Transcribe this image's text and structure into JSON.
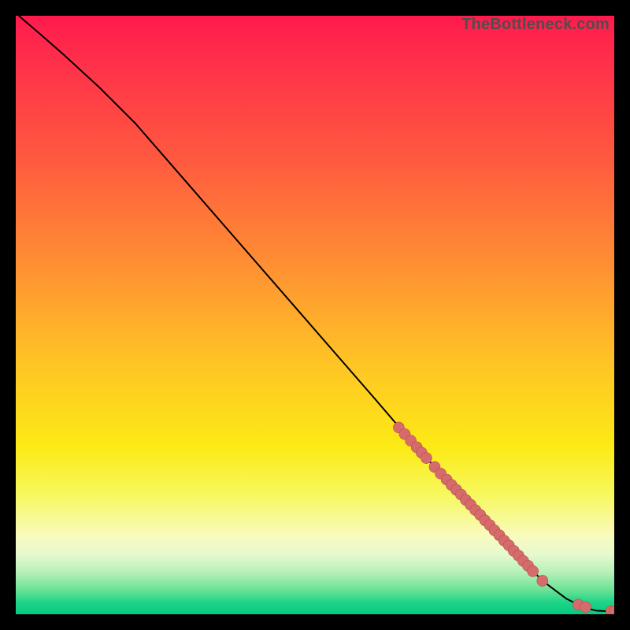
{
  "watermark": "TheBottleneck.com",
  "chart_data": {
    "type": "line",
    "title": "",
    "xlabel": "",
    "ylabel": "",
    "xlim": [
      0,
      100
    ],
    "ylim": [
      0,
      100
    ],
    "curve": {
      "name": "bottleneck-curve",
      "x": [
        0.5,
        4,
        8,
        14,
        20,
        30,
        40,
        50,
        60,
        66,
        70,
        75,
        80,
        85,
        88,
        92,
        95,
        97,
        99,
        100
      ],
      "y": [
        100,
        97,
        93.5,
        88,
        82,
        70.5,
        59,
        47.5,
        36,
        29,
        24.6,
        19.3,
        14,
        8.7,
        5.6,
        2.6,
        1.1,
        0.6,
        0.5,
        0.5
      ]
    },
    "scatter_points": {
      "name": "highlighted-segment",
      "x": [
        64.0,
        65.0,
        66.0,
        67.0,
        67.8,
        68.6,
        70.0,
        71.0,
        72.0,
        72.8,
        73.6,
        74.4,
        75.2,
        76.0,
        76.8,
        77.6,
        78.4,
        79.2,
        80.0,
        80.8,
        81.6,
        82.4,
        83.2,
        84.0,
        84.8,
        85.6,
        86.4,
        88.0,
        94.0,
        95.2,
        99.5,
        100.0
      ],
      "y": [
        31.2,
        30.1,
        29.0,
        27.9,
        27.0,
        26.1,
        24.6,
        23.5,
        22.5,
        21.6,
        20.8,
        20.0,
        19.1,
        18.3,
        17.4,
        16.6,
        15.7,
        14.9,
        14.0,
        13.2,
        12.3,
        11.5,
        10.6,
        9.8,
        8.9,
        8.1,
        7.2,
        5.6,
        1.6,
        1.2,
        0.5,
        0.5
      ]
    },
    "colors": {
      "curve": "#000000",
      "dot_fill": "#d66b6b",
      "dot_stroke": "#b44f4f",
      "gradient_top": "#ff1a4d",
      "gradient_bottom": "#06c983"
    }
  }
}
